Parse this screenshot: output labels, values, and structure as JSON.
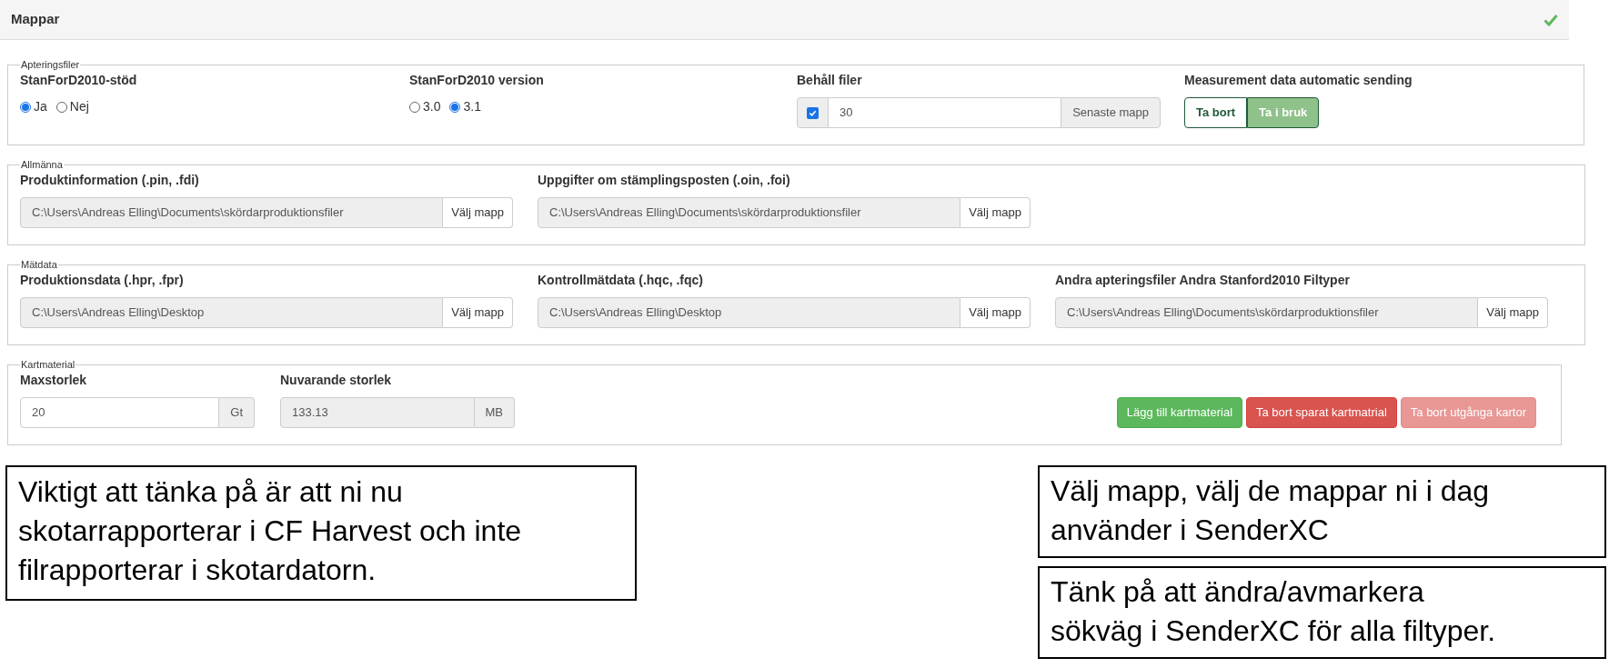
{
  "header": {
    "title": "Mappar",
    "saved": true
  },
  "sections": [
    {
      "legend": "Apteringsfiler",
      "fields": [
        {
          "kind": "radio",
          "label": "StanForD2010-stöd",
          "options": [
            {
              "label": "Ja",
              "selected": true
            },
            {
              "label": "Nej",
              "selected": false
            }
          ]
        },
        {
          "kind": "radio",
          "label": "StanForD2010 version",
          "options": [
            {
              "label": "3.0",
              "selected": false
            },
            {
              "label": "3.1",
              "selected": true
            }
          ]
        },
        {
          "kind": "check-input",
          "label": "Behåll filer",
          "checked": true,
          "value": "30",
          "button": "Senaste mapp"
        },
        {
          "kind": "toggle",
          "label": "Measurement data automatic sending",
          "options": [
            {
              "label": "Ta bort",
              "selected": false
            },
            {
              "label": "Ta i bruk",
              "selected": true
            }
          ]
        }
      ]
    },
    {
      "legend": "Allmänna",
      "fields": [
        {
          "kind": "path",
          "label": "Produktinformation (.pin, .fdi)",
          "value": "C:\\Users\\Andreas Elling\\Documents\\skördarproduktionsfiler",
          "button": "Välj mapp"
        },
        {
          "kind": "path",
          "label": "Uppgifter om stämplingsposten (.oin, .foi)",
          "value": "C:\\Users\\Andreas Elling\\Documents\\skördarproduktionsfiler",
          "button": "Välj mapp"
        }
      ]
    },
    {
      "legend": "Mätdata",
      "fields": [
        {
          "kind": "path",
          "label": "Produktionsdata (.hpr, .fpr)",
          "value": "C:\\Users\\Andreas Elling\\Desktop",
          "button": "Välj mapp"
        },
        {
          "kind": "path",
          "label": "Kontrollmätdata (.hqc, .fqc)",
          "value": "C:\\Users\\Andreas Elling\\Desktop",
          "button": "Välj mapp"
        },
        {
          "kind": "path",
          "label": "Andra apteringsfiler Andra Stanford2010 Filtyper",
          "value": "C:\\Users\\Andreas Elling\\Documents\\skördarproduktionsfiler",
          "button": "Välj mapp"
        }
      ]
    },
    {
      "legend": "Kartmaterial",
      "fields": [
        {
          "kind": "unit",
          "label": "Maxstorlek",
          "value": "20",
          "unit": "Gt",
          "disabled": false
        },
        {
          "kind": "unit",
          "label": "Nuvarande storlek",
          "value": "133.13",
          "unit": "MB",
          "disabled": true
        }
      ],
      "actions": [
        {
          "label": "Lägg till kartmaterial",
          "kind": "success",
          "disabled": false
        },
        {
          "label": "Ta bort sparat kartmatrial",
          "kind": "danger",
          "disabled": false
        },
        {
          "label": "Ta bort utgånga kartor",
          "kind": "danger",
          "disabled": true
        }
      ]
    }
  ],
  "callouts_left": [
    "Viktigt att tänka på är att ni nu\nskotarrapporterar i CF Harvest och inte\nfilrapporterar i skotardatorn."
  ],
  "callouts_right": [
    "Välj mapp, välj de mappar ni i dag\nanvänder i SenderXC",
    "Tänk på att ändra/avmarkera\nsökväg i SenderXC för alla filtyper."
  ]
}
